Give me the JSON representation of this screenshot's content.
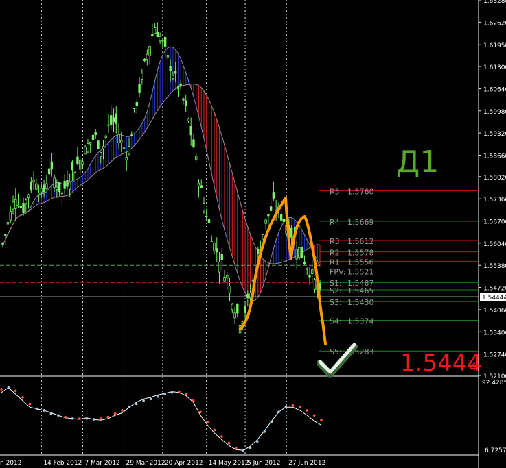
{
  "chart_data": {
    "type": "candlestick",
    "timeframe_label": "Д1",
    "current_price": "1.5444",
    "current_price_suffix": "4",
    "price_axis": {
      "ylim": [
        1.521,
        1.6328
      ],
      "ticks": [
        "1.63280",
        "1.62620",
        "1.61950",
        "1.61300",
        "1.60640",
        "1.59980",
        "1.59320",
        "1.58660",
        "1.58020",
        "1.57360",
        "1.56700",
        "1.56040",
        "1.55380",
        "1.54720",
        "1.54060",
        "1.53400",
        "1.52740",
        "1.52100"
      ],
      "tick_values": [
        1.6328,
        1.6262,
        1.6195,
        1.613,
        1.6064,
        1.5998,
        1.5932,
        1.5866,
        1.5802,
        1.5736,
        1.567,
        1.5604,
        1.5538,
        1.5472,
        1.5406,
        1.534,
        1.5274,
        1.521
      ],
      "current_label": "1.54444"
    },
    "x_axis": {
      "ticks": [
        "n 2012",
        "14 Feb 2012",
        "7 Mar 2012",
        "29 Mar 2012",
        "20 Apr 2012",
        "14 May 2012",
        "5 Jun 2012",
        "27 Jun 2012"
      ],
      "tick_index": [
        0,
        15,
        31,
        47,
        62,
        79,
        94,
        110
      ]
    },
    "pivot_levels": [
      {
        "label": "R5:",
        "value": "1.5760",
        "price": 1.576,
        "color": "#d01010"
      },
      {
        "label": "R4:",
        "value": "1.5669",
        "price": 1.5669,
        "color": "#d01010"
      },
      {
        "label": "R3:",
        "value": "1.5612",
        "price": 1.5612,
        "color": "#d01010"
      },
      {
        "label": "R2:",
        "value": "1.5578",
        "price": 1.5578,
        "color": "#d01010"
      },
      {
        "label": "R1:",
        "value": "1.5556",
        "price": 1.555,
        "color": "#d01010"
      },
      {
        "label": "FPV:",
        "value": "1.5521",
        "price": 1.5521,
        "color": "#a0a040"
      },
      {
        "label": "S1:",
        "value": "1.5487",
        "price": 1.5487,
        "color": "#1a8a1a"
      },
      {
        "label": "S2:",
        "value": "1.5465",
        "price": 1.5465,
        "color": "#1a8a1a"
      },
      {
        "label": "S3:",
        "value": "1.5430",
        "price": 1.543,
        "color": "#1a8a1a"
      },
      {
        "label": "S4:",
        "value": "1.5374",
        "price": 1.5374,
        "color": "#1a8a1a"
      },
      {
        "label": "S5:",
        "value": "1.5283",
        "price": 1.5283,
        "color": "#1a8a1a"
      }
    ],
    "closes_weekly": [
      1.56,
      1.568,
      1.575,
      1.57,
      1.576,
      1.58,
      1.574,
      1.582,
      1.579,
      1.575,
      1.58,
      1.583,
      1.586,
      1.59,
      1.592,
      1.588,
      1.595,
      1.597,
      1.59,
      1.587,
      1.6,
      1.609,
      1.618,
      1.625,
      1.621,
      1.615,
      1.61,
      1.605,
      1.598,
      1.588,
      1.576,
      1.568,
      1.56,
      1.555,
      1.55,
      1.542,
      1.537,
      1.542,
      1.55,
      1.56,
      1.568,
      1.572,
      1.569,
      1.566,
      1.562,
      1.558,
      1.554,
      1.55,
      1.5444
    ],
    "indicator": {
      "ylim": [
        6.7257,
        92.4285
      ],
      "ticks": [
        "92.4285",
        "6.7257"
      ],
      "white_line": [
        80,
        86,
        78,
        70,
        62,
        60,
        58,
        55,
        52,
        49,
        48,
        47,
        49,
        47,
        46,
        48,
        52,
        55,
        62,
        68,
        72,
        74,
        77,
        79,
        81,
        80,
        76,
        68,
        52,
        40,
        30,
        22,
        15,
        10,
        9,
        14,
        22,
        33,
        45,
        56,
        62,
        62,
        58,
        52,
        45,
        40
      ],
      "dots": [
        84,
        86,
        82,
        74,
        66,
        60,
        58,
        54,
        52,
        50,
        48,
        48,
        48,
        47,
        48,
        50,
        54,
        58,
        62,
        66,
        70,
        72,
        75,
        78,
        80,
        81,
        78,
        70,
        56,
        44,
        34,
        26,
        18,
        12,
        9,
        12,
        20,
        32,
        44,
        56,
        62,
        64,
        62,
        58,
        52,
        46
      ]
    }
  }
}
